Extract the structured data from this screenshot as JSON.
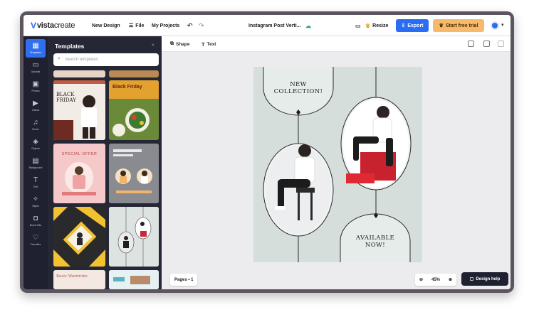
{
  "topbar": {
    "logo_brand": "vista",
    "logo_suffix": "create",
    "new_design": "New Design",
    "file": "File",
    "my_projects": "My Projects",
    "doc_title": "Instagram Post Verti...",
    "resize": "Resize",
    "export": "Export",
    "start_trial": "Start free trial"
  },
  "rail": {
    "items": [
      {
        "label": "Templates",
        "icon": "templates-icon"
      },
      {
        "label": "Uploads",
        "icon": "folder-icon"
      },
      {
        "label": "Photos",
        "icon": "photo-icon"
      },
      {
        "label": "Videos",
        "icon": "video-icon"
      },
      {
        "label": "Music",
        "icon": "music-icon"
      },
      {
        "label": "Objects",
        "icon": "shapes-icon"
      },
      {
        "label": "Background",
        "icon": "background-icon"
      },
      {
        "label": "Text",
        "icon": "text-icon"
      },
      {
        "label": "Styles",
        "icon": "styles-icon"
      },
      {
        "label": "Brand Kits",
        "icon": "brand-kit-icon"
      },
      {
        "label": "Favorites",
        "icon": "heart-icon"
      }
    ]
  },
  "panel": {
    "title": "Templates",
    "search_placeholder": "Search templates",
    "templates": [
      {
        "text": "BLACK FRIDAY"
      },
      {
        "text": "Black Friday"
      },
      {
        "text": "SPECIAL OFFER"
      },
      {
        "text": ""
      },
      {
        "text": ""
      },
      {
        "text": ""
      },
      {
        "text": "Basic Wardrobe"
      },
      {
        "text": ""
      }
    ]
  },
  "toolbar": {
    "shape": "Shape",
    "text": "Text"
  },
  "design": {
    "top_text": "NEW COLLECTION!",
    "bottom_text": "AVAILABLE NOW!"
  },
  "footer": {
    "pages": "Pages • 1",
    "zoom": "45%",
    "design_help": "Design help"
  },
  "colors": {
    "accent_blue": "#2a6df2",
    "trial_orange": "#f7b96b",
    "sidebar_dark": "#1f2030",
    "panel_dark": "#262734",
    "canvas_bg": "#d7dedb"
  }
}
